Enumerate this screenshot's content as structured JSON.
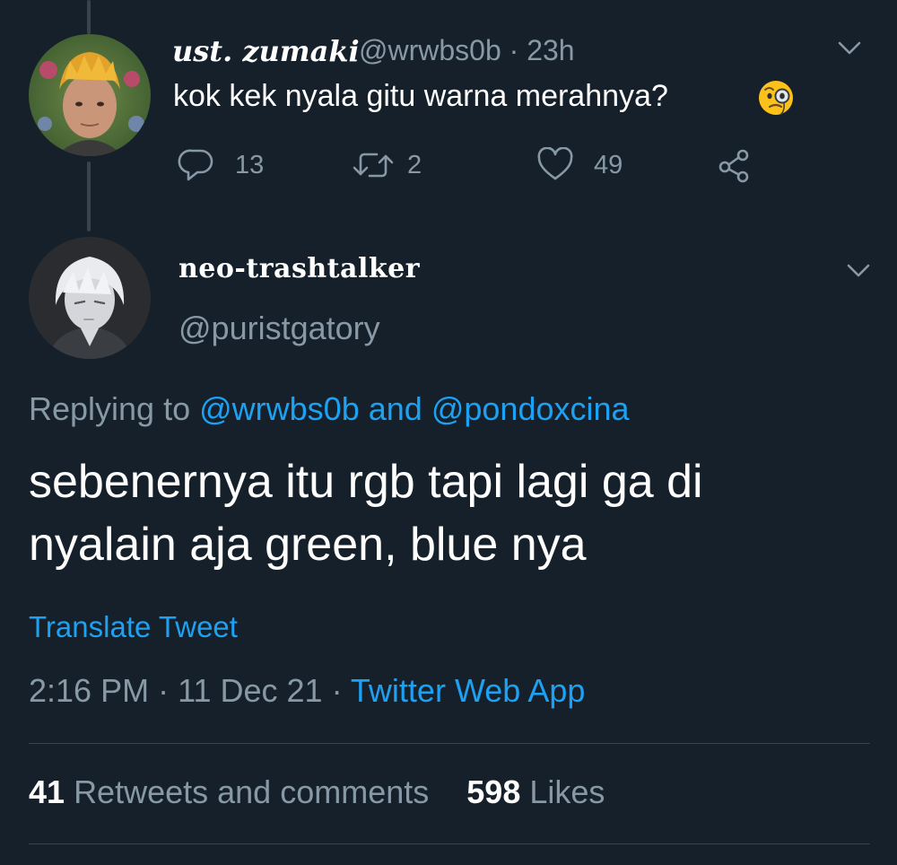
{
  "parent_tweet": {
    "display_name": "ust. zumaki",
    "handle": "@wrwbs0b",
    "separator": "·",
    "time": "23h",
    "text": "kok kek nyala gitu warna merahnya?",
    "emoji": "face-with-monocle",
    "replies": "13",
    "retweets": "2",
    "likes": "49"
  },
  "main_tweet": {
    "display_name": "neo-trashtalker",
    "handle": "@puristgatory",
    "replying_prefix": "Replying to",
    "reply_to_1": "@wrwbs0b",
    "reply_conj": "and",
    "reply_to_2": "@pondoxcina",
    "text": "sebenernya itu rgb tapi lagi ga di nyalain aja green, blue nya",
    "translate": "Translate Tweet",
    "time": "2:16 PM",
    "separator": "·",
    "date": "11 Dec 21",
    "source": "Twitter Web App",
    "retweets_count": "41",
    "retweets_label": "Retweets and comments",
    "likes_count": "598",
    "likes_label": "Likes"
  },
  "colors": {
    "background": "#15202b",
    "text_primary": "#ffffff",
    "text_secondary": "#8899a6",
    "accent": "#1da1f2",
    "divider": "#38444d"
  }
}
